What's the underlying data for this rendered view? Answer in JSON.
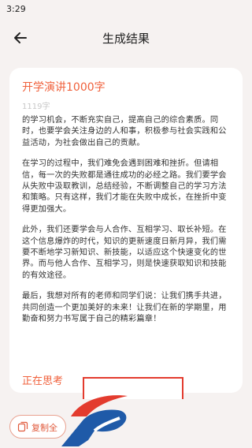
{
  "status_bar": {
    "time": "3:29"
  },
  "header": {
    "title": "生成结果"
  },
  "document": {
    "title": "开学演讲1000字",
    "char_count": "1119字",
    "paragraphs": [
      "的学习机会，不断充实自己，提高自己的综合素质。同时，也要学会关注身边的人和事，积极参与社会实践和公益活动，为社会做出自己的贡献。",
      "在学习的过程中，我们难免会遇到困难和挫折。但请相信，每一次的失败都是通往成功的必经之路。我们要学会从失败中汲取教训，总结经验，不断调整自己的学习方法和策略。只有这样，我们才能在失败中成长，在挫折中变得更加强大。",
      "此外，我们还要学会与人合作、互相学习、取长补短。在这个信息爆炸的时代，知识的更新速度日新月异，我们需要不断地学习新知识、新技能，以适应这个快速变化的世界。而与他人合作、互相学习，则是快速获取知识和技能的有效途径。",
      "最后，我想对所有的老师和同学们说：让我们携手共进，共同创造一个更加美好的未来！让我们在新的学期里，用勤奋和努力书写属于自己的精彩篇章！"
    ],
    "status": "正在思考"
  },
  "actions": {
    "copy_label": "复制全"
  },
  "colors": {
    "accent": "#f0613c",
    "background": "#f6f2f1",
    "highlight_box": "#e33b2e"
  },
  "icons": {
    "back": "arrow-left-icon",
    "copy": "copy-icon",
    "logo": "brand-logo-icon"
  }
}
